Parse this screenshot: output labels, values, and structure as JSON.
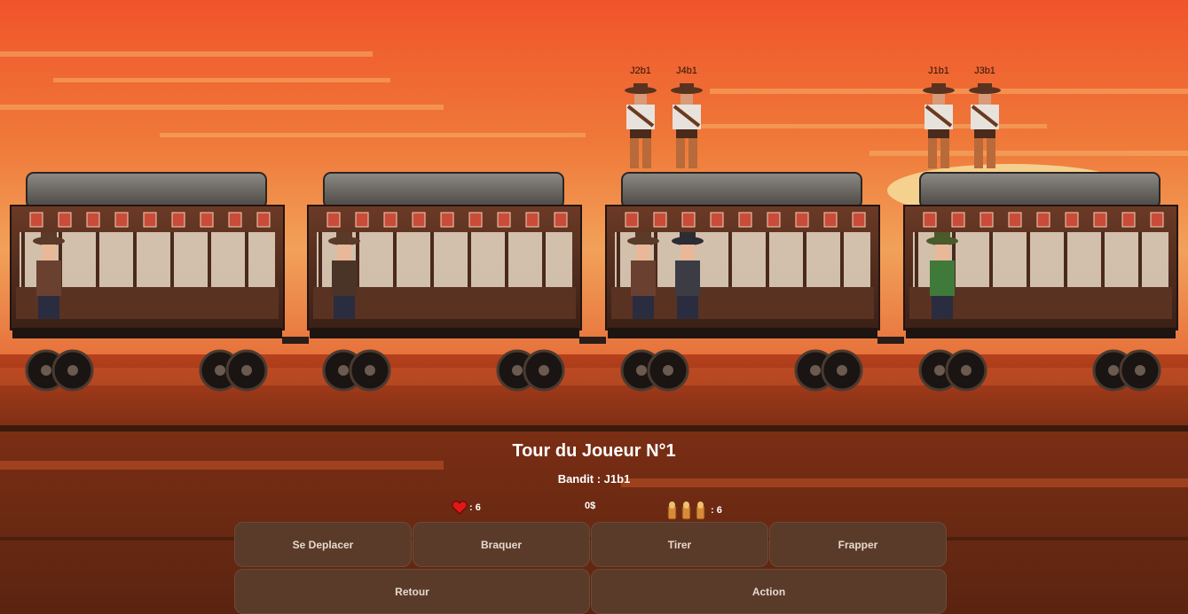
{
  "scene": {
    "bandits_on_roof": [
      {
        "label": "J2b1",
        "wagon": 3
      },
      {
        "label": "J4b1",
        "wagon": 3
      },
      {
        "label": "J1b1",
        "wagon": 4
      },
      {
        "label": "J3b1",
        "wagon": 4
      }
    ]
  },
  "hud": {
    "turn_title": "Tour du Joueur N°1",
    "bandit_line": "Bandit : J1b1",
    "health": ": 6",
    "money": "0$",
    "ammo": ": 6"
  },
  "buttons": {
    "move": "Se Deplacer",
    "rob": "Braquer",
    "shoot": "Tirer",
    "punch": "Frapper",
    "back": "Retour",
    "action": "Action"
  },
  "colors": {
    "sky_top": "#f0542a",
    "sky_bottom": "#f2a15a",
    "ground": "#7a2e14",
    "button_bg": "#5a3b2a"
  }
}
